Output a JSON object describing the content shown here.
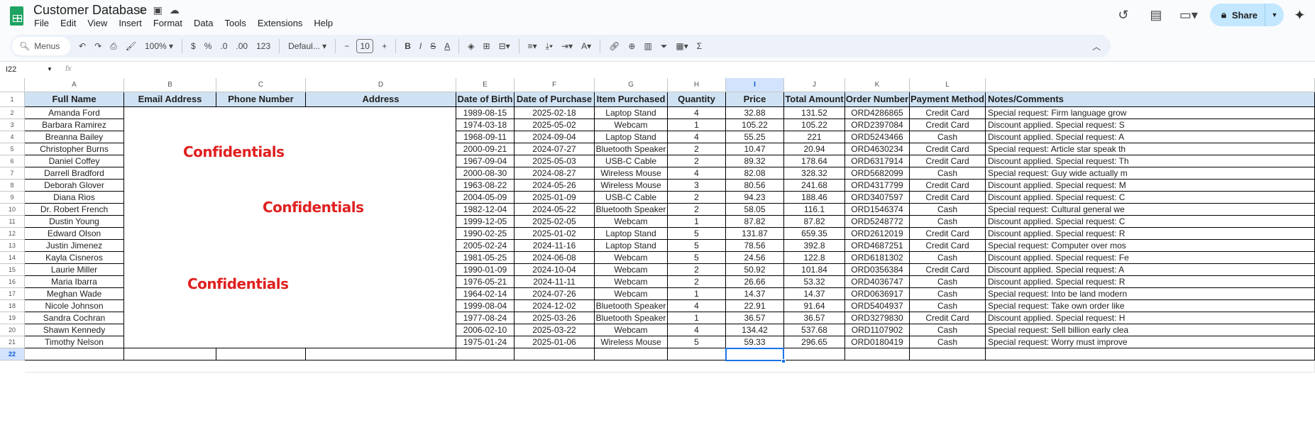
{
  "doc": {
    "title": "Customer Database",
    "menus": [
      "File",
      "Edit",
      "View",
      "Insert",
      "Format",
      "Data",
      "Tools",
      "Extensions",
      "Help"
    ],
    "share_label": "Share"
  },
  "toolbar": {
    "search": "Menus",
    "zoom": "100%",
    "currency": "$",
    "percent": "%",
    "dec_dec": ".0",
    "inc_dec": ".00",
    "format_123": "123",
    "font": "Defaul...",
    "font_size": "10",
    "bold": "B",
    "italic": "I",
    "strike": "S",
    "text_color": "A",
    "sum": "Σ"
  },
  "formula": {
    "cell_ref": "I22",
    "fx": "fx",
    "value": ""
  },
  "columns": [
    "A",
    "B",
    "C",
    "D",
    "E",
    "F",
    "G",
    "H",
    "I",
    "J",
    "K",
    "L",
    ""
  ],
  "headers": [
    "Full Name",
    "Email Address",
    "Phone Number",
    "Address",
    "Date of Birth",
    "Date of Purchase",
    "Item Purchased",
    "Quantity",
    "Price",
    "Total Amount",
    "Order Number",
    "Payment Method",
    "Notes/Comments"
  ],
  "confidential_label": "Confidentials",
  "rows": [
    [
      "Amanda Ford",
      "1989-08-15",
      "2025-02-18",
      "Laptop Stand",
      "4",
      "32.88",
      "131.52",
      "ORD4286865",
      "Credit Card",
      "Special request: Firm language grow"
    ],
    [
      "Barbara Ramirez",
      "1974-03-18",
      "2025-05-02",
      "Webcam",
      "1",
      "105.22",
      "105.22",
      "ORD2397084",
      "Credit Card",
      "Discount applied. Special request: S"
    ],
    [
      "Breanna Bailey",
      "1968-09-11",
      "2024-09-04",
      "Laptop Stand",
      "4",
      "55.25",
      "221",
      "ORD5243466",
      "Cash",
      "Discount applied. Special request: A"
    ],
    [
      "Christopher Burns",
      "2000-09-21",
      "2024-07-27",
      "Bluetooth Speaker",
      "2",
      "10.47",
      "20.94",
      "ORD4630234",
      "Credit Card",
      "Special request: Article star speak th"
    ],
    [
      "Daniel Coffey",
      "1967-09-04",
      "2025-05-03",
      "USB-C Cable",
      "2",
      "89.32",
      "178.64",
      "ORD6317914",
      "Credit Card",
      "Discount applied. Special request: Th"
    ],
    [
      "Darrell Bradford",
      "2000-08-30",
      "2024-08-27",
      "Wireless Mouse",
      "4",
      "82.08",
      "328.32",
      "ORD5682099",
      "Cash",
      "Special request: Guy wide actually m"
    ],
    [
      "Deborah Glover",
      "1963-08-22",
      "2024-05-26",
      "Wireless Mouse",
      "3",
      "80.56",
      "241.68",
      "ORD4317799",
      "Credit Card",
      "Discount applied. Special request: M"
    ],
    [
      "Diana Rios",
      "2004-05-09",
      "2025-01-09",
      "USB-C Cable",
      "2",
      "94.23",
      "188.46",
      "ORD3407597",
      "Credit Card",
      "Discount applied. Special request: C"
    ],
    [
      "Dr. Robert French",
      "1982-12-04",
      "2024-05-22",
      "Bluetooth Speaker",
      "2",
      "58.05",
      "116.1",
      "ORD1546374",
      "Cash",
      "Special request: Cultural general we"
    ],
    [
      "Dustin Young",
      "1999-12-05",
      "2025-02-05",
      "Webcam",
      "1",
      "87.82",
      "87.82",
      "ORD5248772",
      "Cash",
      "Discount applied. Special request: C"
    ],
    [
      "Edward Olson",
      "1990-02-25",
      "2025-01-02",
      "Laptop Stand",
      "5",
      "131.87",
      "659.35",
      "ORD2612019",
      "Credit Card",
      "Discount applied. Special request: R"
    ],
    [
      "Justin Jimenez",
      "2005-02-24",
      "2024-11-16",
      "Laptop Stand",
      "5",
      "78.56",
      "392.8",
      "ORD4687251",
      "Credit Card",
      "Special request: Computer over mos"
    ],
    [
      "Kayla Cisneros",
      "1981-05-25",
      "2024-06-08",
      "Webcam",
      "5",
      "24.56",
      "122.8",
      "ORD6181302",
      "Cash",
      "Discount applied. Special request: Fe"
    ],
    [
      "Laurie Miller",
      "1990-01-09",
      "2024-10-04",
      "Webcam",
      "2",
      "50.92",
      "101.84",
      "ORD0356384",
      "Credit Card",
      "Discount applied. Special request: A"
    ],
    [
      "Maria Ibarra",
      "1976-05-21",
      "2024-11-11",
      "Webcam",
      "2",
      "26.66",
      "53.32",
      "ORD4036747",
      "Cash",
      "Discount applied. Special request: R"
    ],
    [
      "Meghan Wade",
      "1964-02-14",
      "2024-07-26",
      "Webcam",
      "1",
      "14.37",
      "14.37",
      "ORD0636917",
      "Cash",
      "Special request: Into be land modern"
    ],
    [
      "Nicole Johnson",
      "1999-08-04",
      "2024-12-02",
      "Bluetooth Speaker",
      "4",
      "22.91",
      "91.64",
      "ORD5404937",
      "Cash",
      "Special request: Take own order like"
    ],
    [
      "Sandra Cochran",
      "1977-08-24",
      "2025-03-26",
      "Bluetooth Speaker",
      "1",
      "36.57",
      "36.57",
      "ORD3279830",
      "Credit Card",
      "Discount applied. Special request: H"
    ],
    [
      "Shawn Kennedy",
      "2006-02-10",
      "2025-03-22",
      "Webcam",
      "4",
      "134.42",
      "537.68",
      "ORD1107902",
      "Cash",
      "Special request: Sell billion early clea"
    ],
    [
      "Timothy Nelson",
      "1975-01-24",
      "2025-01-06",
      "Wireless Mouse",
      "5",
      "59.33",
      "296.65",
      "ORD0180419",
      "Cash",
      "Special request: Worry must improve"
    ]
  ],
  "row_numbers": [
    "1",
    "2",
    "3",
    "4",
    "5",
    "6",
    "7",
    "8",
    "9",
    "10",
    "11",
    "12",
    "13",
    "14",
    "15",
    "16",
    "17",
    "18",
    "19",
    "20",
    "21",
    "22"
  ],
  "colors": {
    "header_fill": "#cfe2f3",
    "accent": "#1a73e8",
    "confidential": "#e02020"
  }
}
